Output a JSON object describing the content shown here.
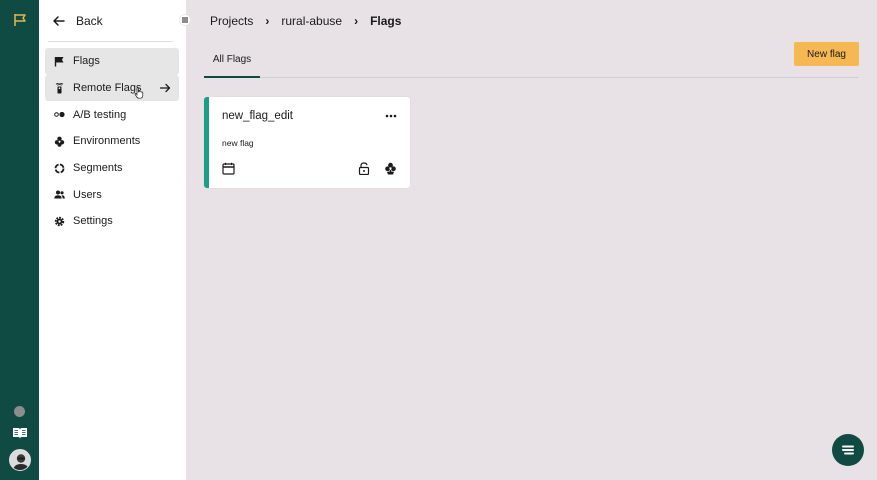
{
  "sidebar": {
    "back_label": "Back",
    "items": [
      {
        "label": "Flags",
        "icon": "flag-icon",
        "state": "active"
      },
      {
        "label": "Remote Flags",
        "icon": "remote-icon",
        "state": "hover"
      },
      {
        "label": "A/B testing",
        "icon": "ab-testing-icon"
      },
      {
        "label": "Environments",
        "icon": "environments-icon"
      },
      {
        "label": "Segments",
        "icon": "segments-icon"
      },
      {
        "label": "Users",
        "icon": "users-icon"
      },
      {
        "label": "Settings",
        "icon": "gear-icon"
      }
    ]
  },
  "breadcrumb": {
    "items": [
      "Projects",
      "rural-abuse",
      "Flags"
    ]
  },
  "tabs": [
    {
      "label": "All Flags",
      "selected": true
    }
  ],
  "toolbar": {
    "new_flag_label": "New flag"
  },
  "flag_cards": [
    {
      "name": "new_flag_edit",
      "description": "new flag"
    }
  ],
  "colors": {
    "rail": "#0f4a43",
    "accent_button": "#f5b853",
    "card_stripe": "#1a9e86",
    "background": "#e8e2e6"
  }
}
